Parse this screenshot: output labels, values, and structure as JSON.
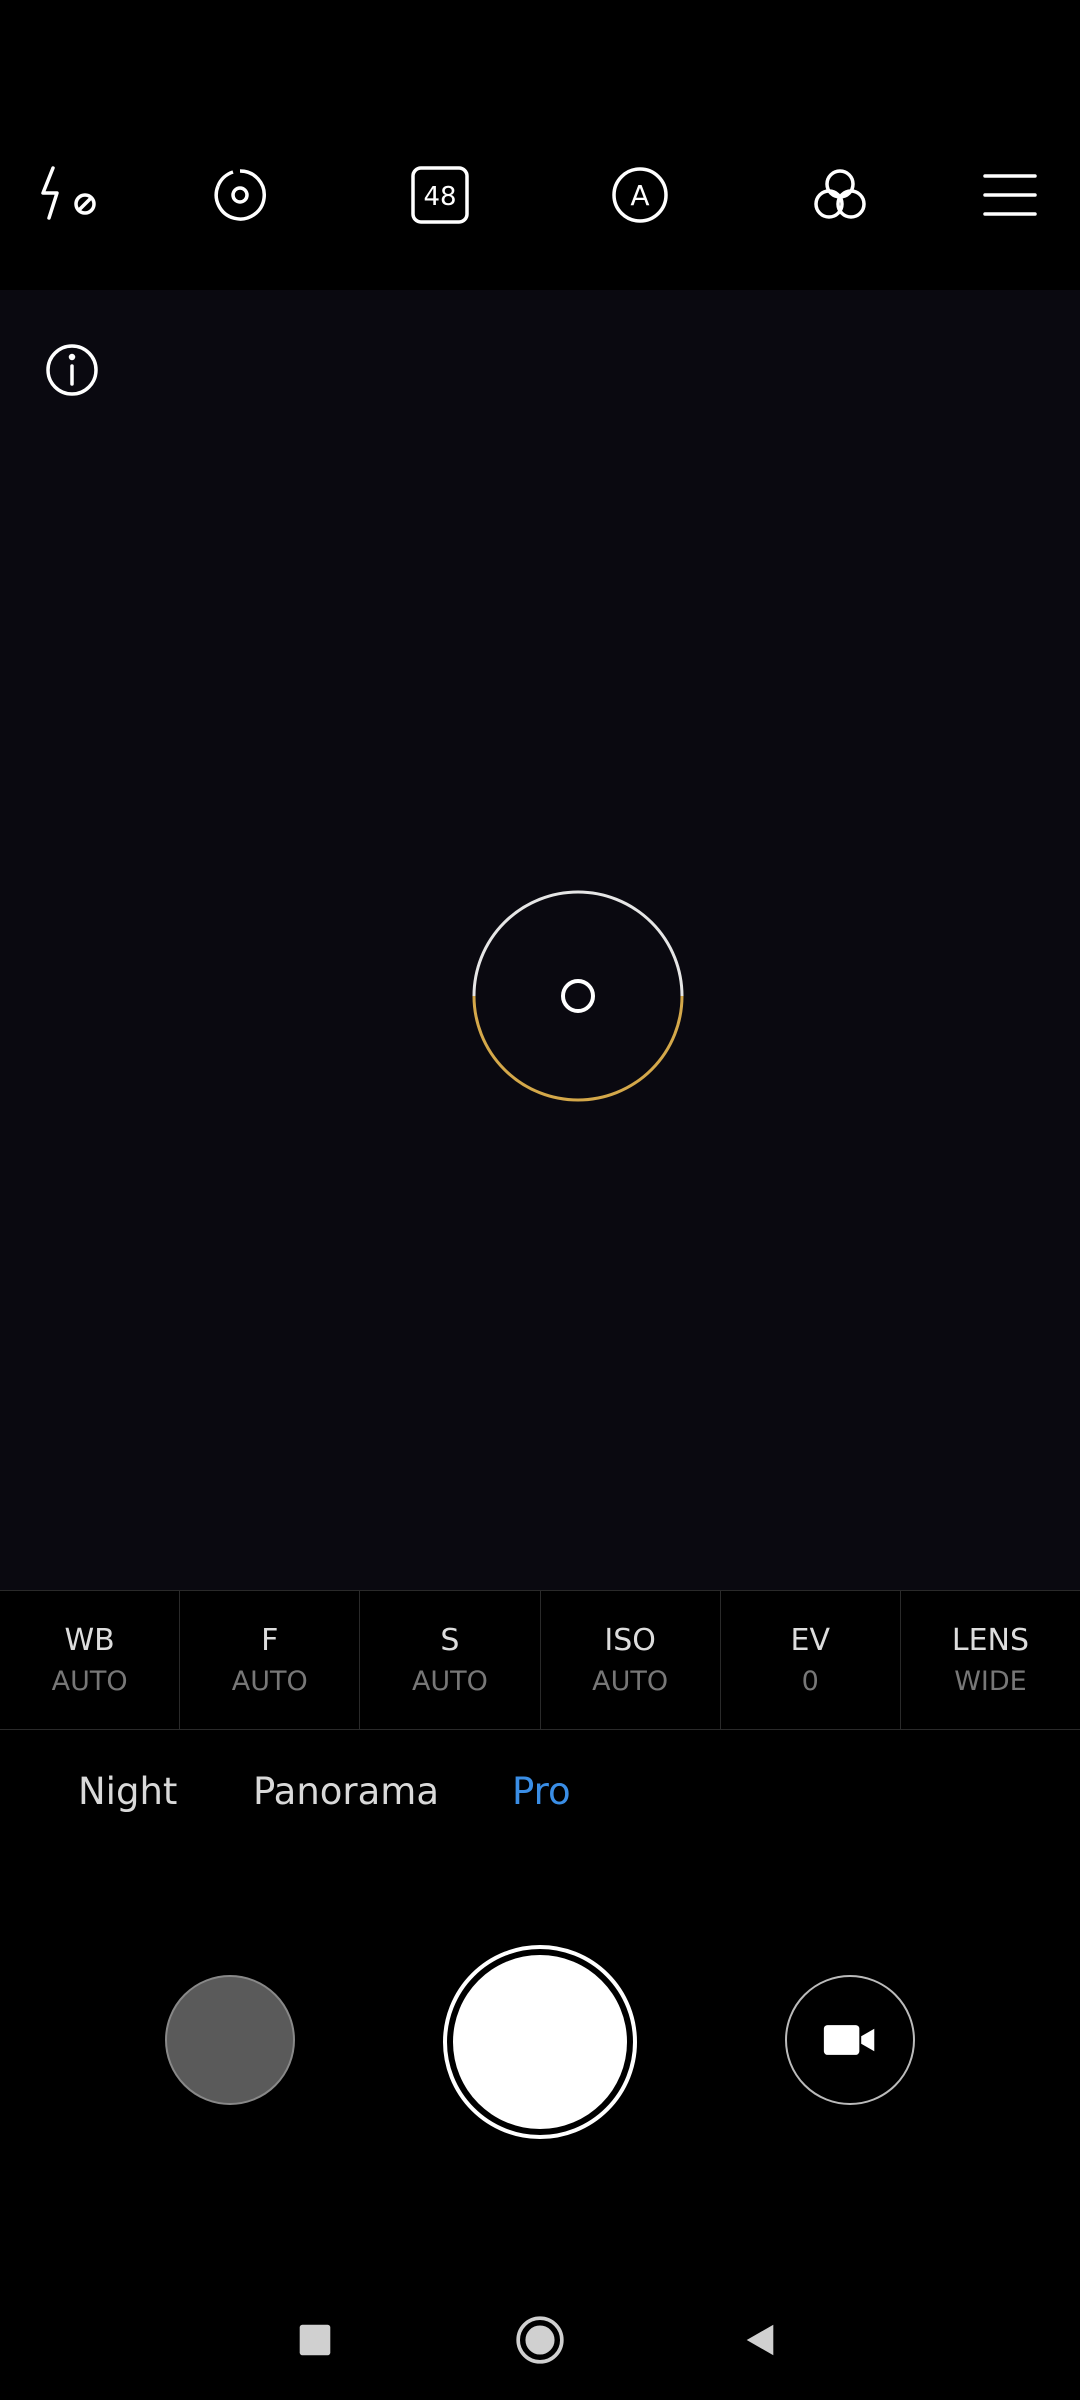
{
  "top_icons": [
    {
      "name": "flash-off-icon"
    },
    {
      "name": "hdr-icon"
    },
    {
      "name": "48mp-icon",
      "text": "48"
    },
    {
      "name": "ai-icon",
      "text": "A"
    },
    {
      "name": "filters-icon"
    },
    {
      "name": "menu-icon"
    }
  ],
  "params": [
    {
      "label": "WB",
      "value": "AUTO"
    },
    {
      "label": "F",
      "value": "AUTO"
    },
    {
      "label": "S",
      "value": "AUTO"
    },
    {
      "label": "ISO",
      "value": "AUTO"
    },
    {
      "label": "EV",
      "value": "0"
    },
    {
      "label": "LENS",
      "value": "WIDE"
    }
  ],
  "modes": [
    {
      "label": "Night",
      "active": false
    },
    {
      "label": "Panorama",
      "active": false
    },
    {
      "label": "Pro",
      "active": true
    }
  ],
  "colors": {
    "accent": "#3a8ee6",
    "focus_ring_lower": "#d4a84a",
    "focus_ring_upper": "#e6e6e6"
  }
}
